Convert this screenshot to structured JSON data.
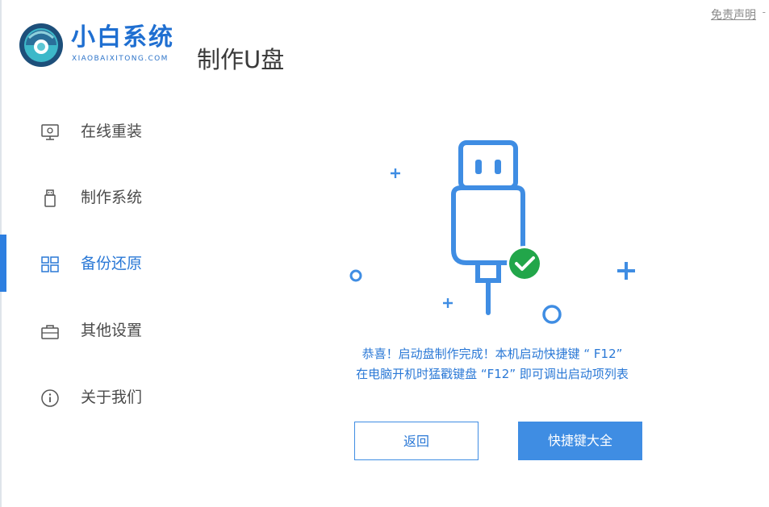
{
  "header": {
    "brand_name": "小白系统",
    "brand_sub": "XIAOBAIXITONG.COM",
    "page_title": "制作U盘",
    "disclaimer": "免责声明",
    "minimize": "-"
  },
  "sidebar": {
    "items": [
      {
        "label": "在线重装",
        "icon": "monitor-icon",
        "active": false
      },
      {
        "label": "制作系统",
        "icon": "usb-drive-icon",
        "active": false
      },
      {
        "label": "备份还原",
        "icon": "grid-icon",
        "active": true
      },
      {
        "label": "其他设置",
        "icon": "toolbox-icon",
        "active": false
      },
      {
        "label": "关于我们",
        "icon": "info-icon",
        "active": false
      }
    ]
  },
  "main": {
    "illustration_icon": "usb-success-icon",
    "message_line1": "恭喜！启动盘制作完成！本机启动快捷键 “ F12”",
    "message_line2": "在电脑开机时猛戳键盘 “F12” 即可调出启动项列表",
    "back_button": "返回",
    "shortcut_button": "快捷键大全"
  },
  "colors": {
    "accent": "#3f8de3",
    "text_blue": "#2a78d6",
    "success": "#22a64a"
  }
}
